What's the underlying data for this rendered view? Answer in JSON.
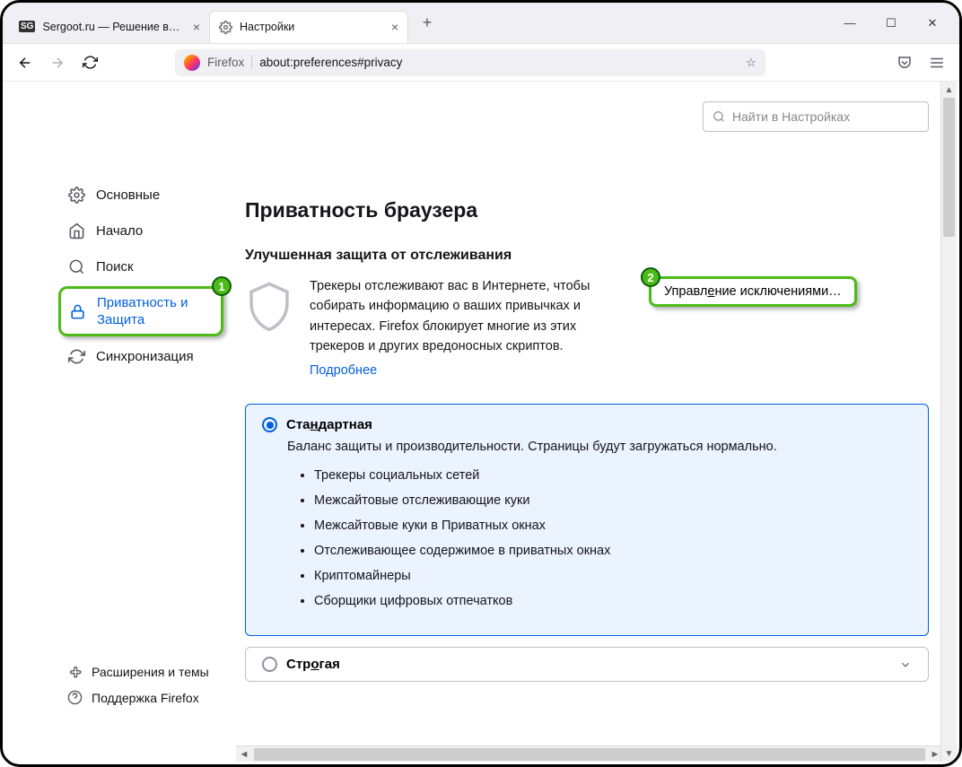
{
  "tabs": {
    "inactive": {
      "title": "Sergoot.ru — Решение ваших IT",
      "favicon": "SG"
    },
    "active": {
      "title": "Настройки"
    }
  },
  "url": {
    "browser_label": "Firefox",
    "address": "about:preferences#privacy"
  },
  "search": {
    "placeholder": "Найти в Настройках"
  },
  "sidebar": {
    "items": [
      {
        "label": "Основные"
      },
      {
        "label": "Начало"
      },
      {
        "label": "Поиск"
      },
      {
        "label": "Приватность и Защита"
      },
      {
        "label": "Синхронизация"
      }
    ],
    "footer": [
      {
        "label": "Расширения и темы"
      },
      {
        "label": "Поддержка Firefox"
      }
    ]
  },
  "page": {
    "title": "Приватность браузера",
    "subtitle": "Улучшенная защита от отслеживания",
    "tracking_desc": "Трекеры отслеживают вас в Интернете, чтобы собирать информацию о ваших привычках и интересах. Firefox блокирует многие из этих трекеров и других вредоносных скриптов.",
    "learn_more": "Подробнее",
    "exceptions_pre": "Управл",
    "exceptions_ul": "е",
    "exceptions_post": "ние исключениями…",
    "standard": {
      "label_pre": "Ста",
      "label_ul": "н",
      "label_post": "дартная",
      "desc": "Баланс защиты и производительности. Страницы будут загружаться нормально.",
      "items": [
        "Трекеры социальных сетей",
        "Межсайтовые отслеживающие куки",
        "Межсайтовые куки в Приватных окнах",
        "Отслеживающее содержимое в приватных окнах",
        "Криптомайнеры",
        "Сборщики цифровых отпечатков"
      ]
    },
    "strict": {
      "label_pre": "Стр",
      "label_ul": "о",
      "label_post": "гая"
    }
  },
  "callouts": {
    "sidebar": "1",
    "exceptions": "2"
  }
}
